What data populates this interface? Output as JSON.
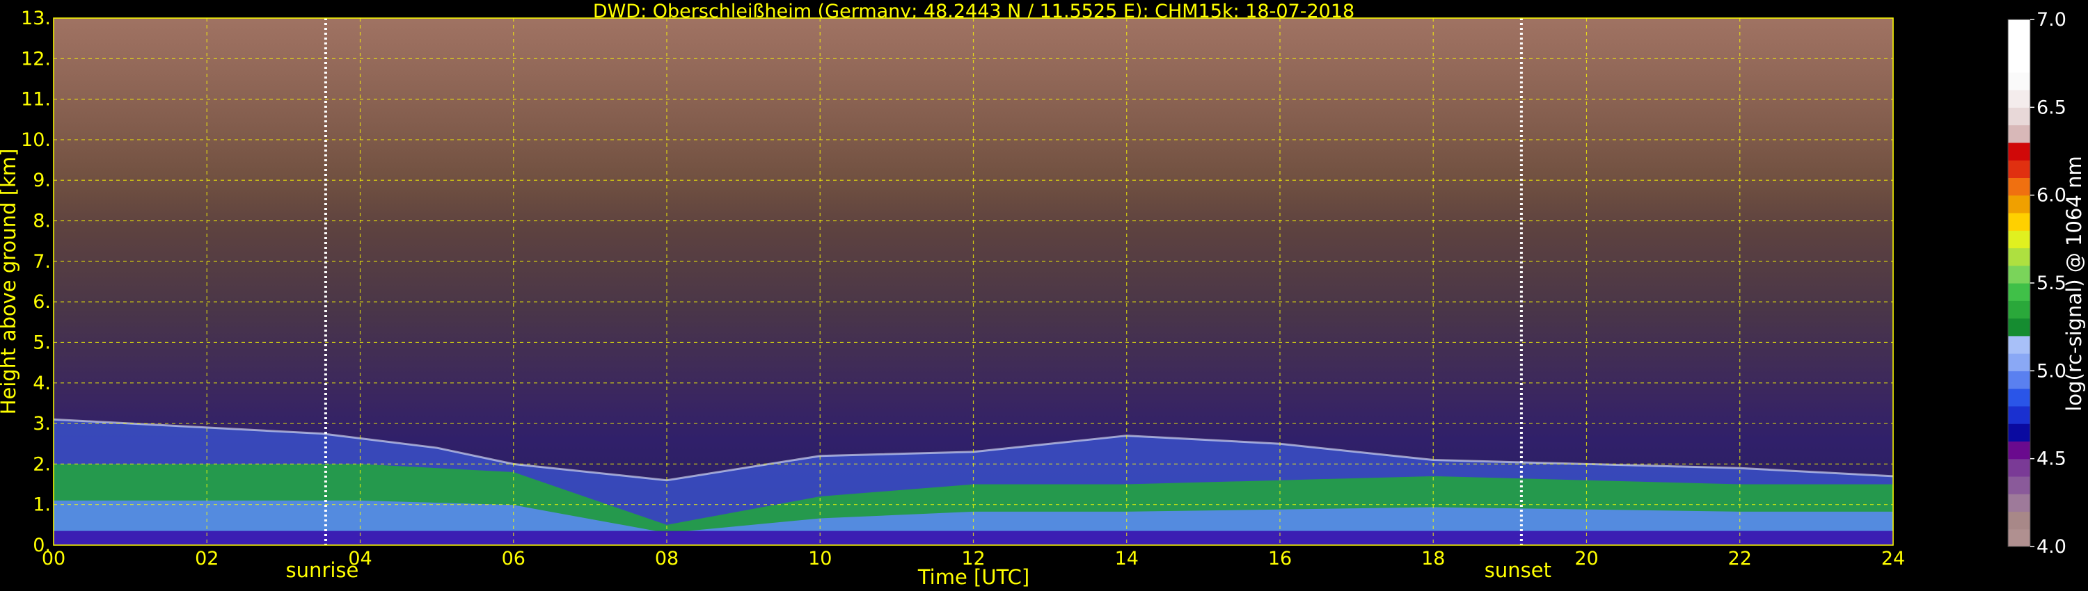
{
  "chart_data": {
    "type": "heatmap",
    "title": "DWD: Oberschleißheim (Germany; 48.2443 N / 11.5525 E):    CHM15k: 18-07-2018",
    "xlabel": "Time [UTC]",
    "ylabel": "Height above ground [km]",
    "xlim": [
      0,
      24
    ],
    "ylim": [
      0,
      13
    ],
    "x_ticks": [
      "00",
      "02",
      "04",
      "06",
      "08",
      "10",
      "12",
      "14",
      "16",
      "18",
      "20",
      "22",
      "24"
    ],
    "y_ticks": [
      "0.",
      "1.",
      "2.",
      "3.",
      "4.",
      "5.",
      "6.",
      "7.",
      "8.",
      "9.",
      "10.",
      "11.",
      "12.",
      "13."
    ],
    "grid": true,
    "events": [
      {
        "label": "sunrise",
        "time": 3.55
      },
      {
        "label": "sunset",
        "time": 19.15
      }
    ],
    "colorbar": {
      "label": "log(rc-signal) @ 1064 nm",
      "range": [
        4.0,
        7.0
      ],
      "ticks": [
        "4.0",
        "4.5",
        "5.0",
        "5.5",
        "6.0",
        "6.5",
        "7.0"
      ],
      "colors": [
        "#b09090",
        "#a88888",
        "#9e7a9a",
        "#8a5a9a",
        "#7a3a96",
        "#6a0a8e",
        "#0a0aa0",
        "#1a30d0",
        "#2a55e8",
        "#5a80f0",
        "#8aa8f5",
        "#a8c0f8",
        "#158c30",
        "#2aa83a",
        "#40c048",
        "#7ad45a",
        "#aee040",
        "#e0f020",
        "#ffd000",
        "#f0a000",
        "#f07010",
        "#e03010",
        "#d00808",
        "#d8b8b8",
        "#e8d8d8",
        "#f4ecec",
        "#fafafa",
        "#ffffff",
        "#ffffff",
        "#ffffff"
      ]
    },
    "layers": [
      {
        "name": "surface",
        "points": [
          [
            0,
            0.05
          ],
          [
            24,
            0.05
          ]
        ]
      },
      {
        "name": "boundary layer top",
        "points": [
          [
            0,
            3.1
          ],
          [
            2,
            2.9
          ],
          [
            3.5,
            2.75
          ],
          [
            5,
            2.4
          ],
          [
            6,
            2.0
          ],
          [
            8,
            1.6
          ],
          [
            10,
            2.2
          ],
          [
            12,
            2.3
          ],
          [
            14,
            2.7
          ],
          [
            16,
            2.5
          ],
          [
            18,
            2.1
          ],
          [
            20,
            2.0
          ],
          [
            22,
            1.9
          ],
          [
            24,
            1.7
          ]
        ]
      },
      {
        "name": "green layer",
        "points": [
          [
            0,
            2.0
          ],
          [
            2,
            2.0
          ],
          [
            4,
            2.0
          ],
          [
            6,
            1.8
          ],
          [
            8,
            0.5
          ],
          [
            10,
            1.2
          ],
          [
            12,
            1.5
          ],
          [
            14,
            1.5
          ],
          [
            16,
            1.6
          ],
          [
            18,
            1.7
          ],
          [
            20,
            1.6
          ],
          [
            22,
            1.5
          ],
          [
            24,
            1.5
          ]
        ]
      }
    ]
  }
}
